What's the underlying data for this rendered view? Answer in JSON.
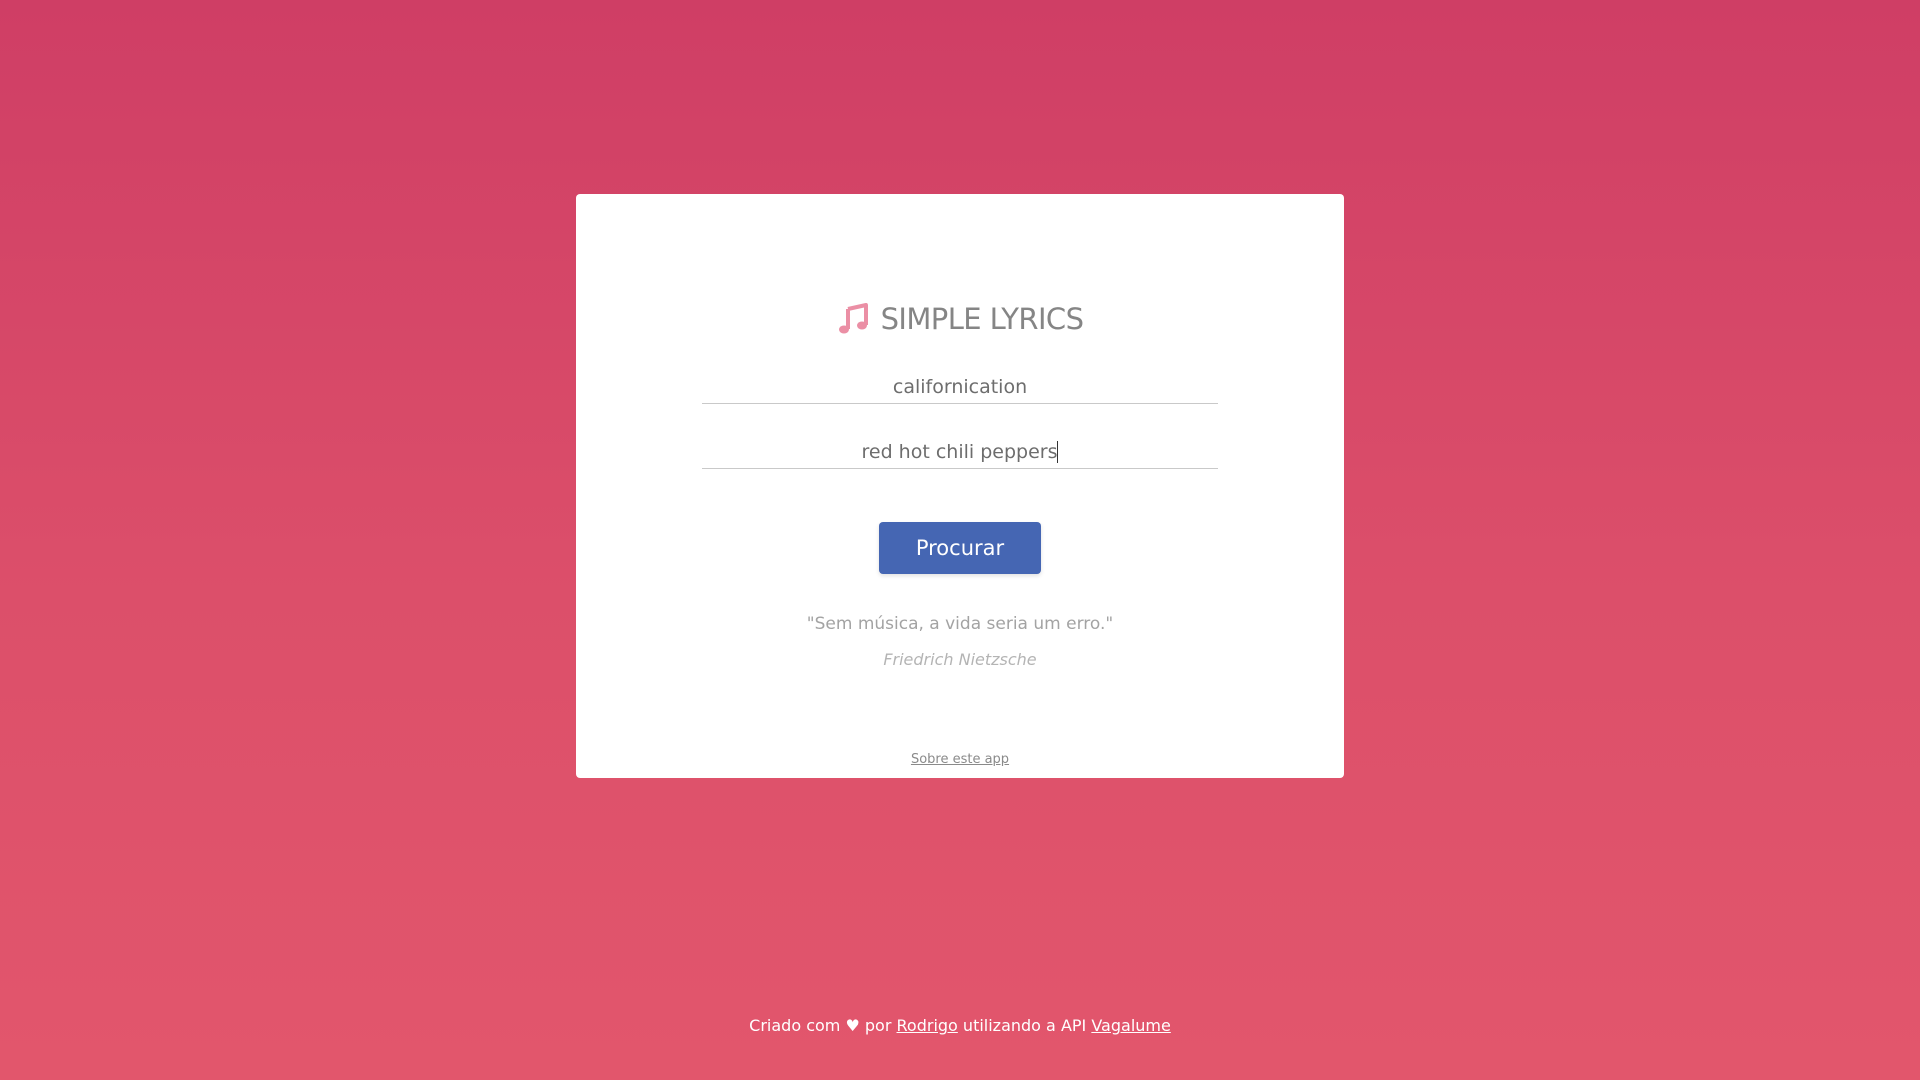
{
  "app": {
    "title": "SIMPLE LYRICS",
    "logo_icon": "music-note-icon",
    "accent_color": "#eb8fa5"
  },
  "form": {
    "song_value": "californication",
    "artist_value": "red hot chili peppers",
    "submit_label": "Procurar",
    "button_color": "#4566b3"
  },
  "quote": {
    "text": "\"Sem música, a vida seria um erro.\"",
    "author": "Friedrich Nietzsche"
  },
  "card_footer": {
    "about_link": "Sobre este app"
  },
  "footer": {
    "prefix": "Criado com",
    "heart": "♥",
    "by": "por",
    "author_link": "Rodrigo",
    "middle": "utilizando a API",
    "api_link": "Vagalume"
  },
  "background": {
    "gradient_top": "#cf3e65",
    "gradient_bottom": "#e2566c"
  }
}
